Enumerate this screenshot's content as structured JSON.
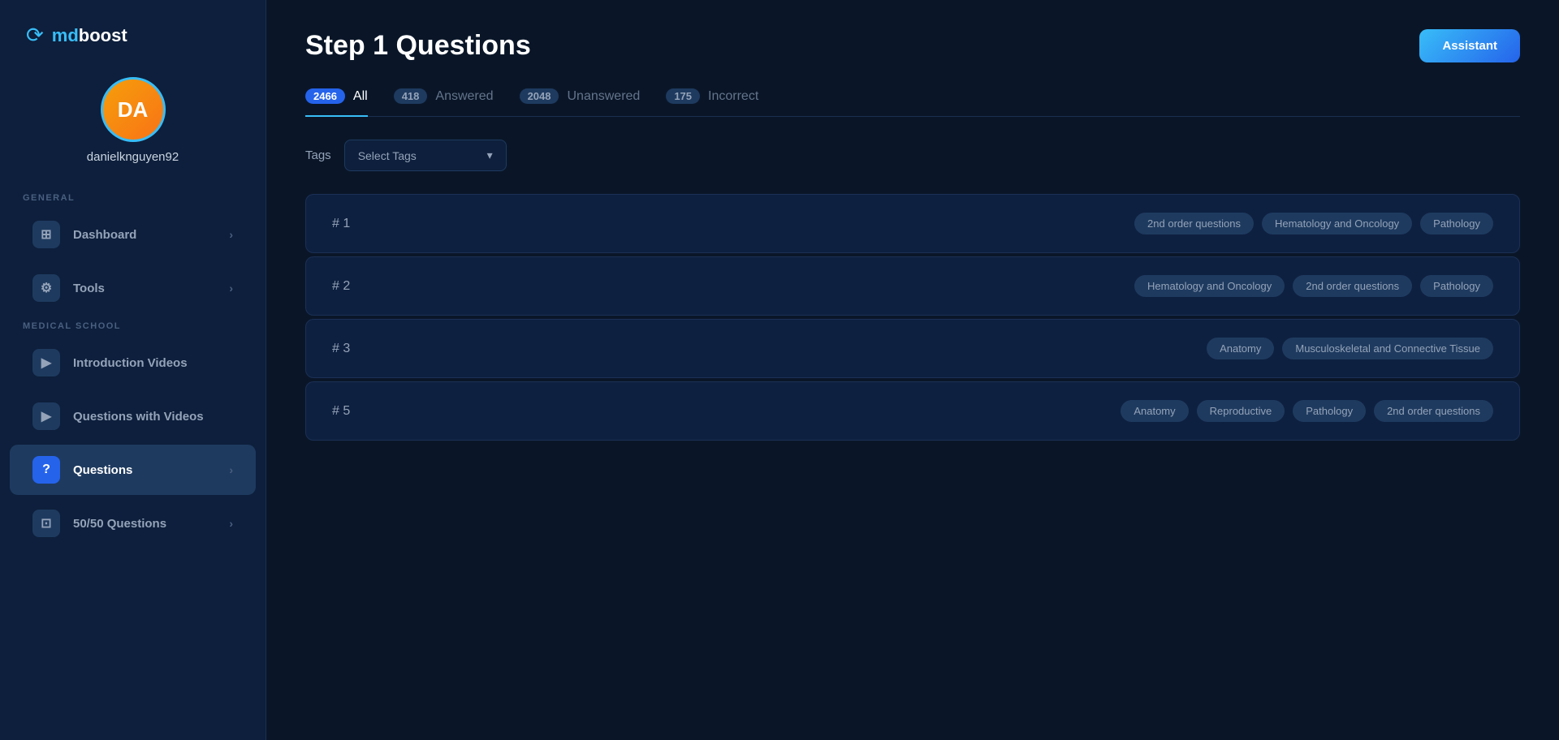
{
  "sidebar": {
    "logo_icon": "⟳",
    "logo_md": "md",
    "logo_boost": "boost",
    "avatar_initials": "DA",
    "username": "danielknguyen92",
    "general_label": "GENERAL",
    "medical_school_label": "MEDICAL SCHOOL",
    "nav_items_general": [
      {
        "id": "dashboard",
        "icon": "⊞",
        "label": "Dashboard",
        "chevron": true,
        "active": false
      },
      {
        "id": "tools",
        "icon": "⚙",
        "label": "Tools",
        "chevron": true,
        "active": false
      }
    ],
    "nav_items_medical": [
      {
        "id": "intro-videos",
        "icon": "▶",
        "label": "Introduction Videos",
        "chevron": false,
        "active": false
      },
      {
        "id": "questions-with-videos",
        "icon": "▶",
        "label": "Questions with Videos",
        "chevron": false,
        "active": false
      },
      {
        "id": "questions",
        "icon": "?",
        "label": "Questions",
        "chevron": true,
        "active": true
      },
      {
        "id": "50-50-questions",
        "icon": "⊡",
        "label": "50/50 Questions",
        "chevron": true,
        "active": false
      }
    ]
  },
  "main": {
    "page_title": "Step 1 Questions",
    "assistant_btn_label": "Assistant",
    "tabs": [
      {
        "id": "all",
        "badge": "2466",
        "label": "All",
        "active": true
      },
      {
        "id": "answered",
        "badge": "418",
        "label": "Answered",
        "active": false
      },
      {
        "id": "unanswered",
        "badge": "2048",
        "label": "Unanswered",
        "active": false
      },
      {
        "id": "incorrect",
        "badge": "175",
        "label": "Incorrect",
        "active": false
      }
    ],
    "tags_label": "Tags",
    "tags_placeholder": "Select Tags",
    "questions": [
      {
        "num": "# 1",
        "tags": [
          "2nd order questions",
          "Hematology and Oncology",
          "Pathology"
        ]
      },
      {
        "num": "# 2",
        "tags": [
          "Hematology and Oncology",
          "2nd order questions",
          "Pathology"
        ]
      },
      {
        "num": "# 3",
        "tags": [
          "Anatomy",
          "Musculoskeletal and Connective Tissue"
        ]
      },
      {
        "num": "# 5",
        "tags": [
          "Anatomy",
          "Reproductive",
          "Pathology",
          "2nd order questions"
        ]
      }
    ]
  }
}
